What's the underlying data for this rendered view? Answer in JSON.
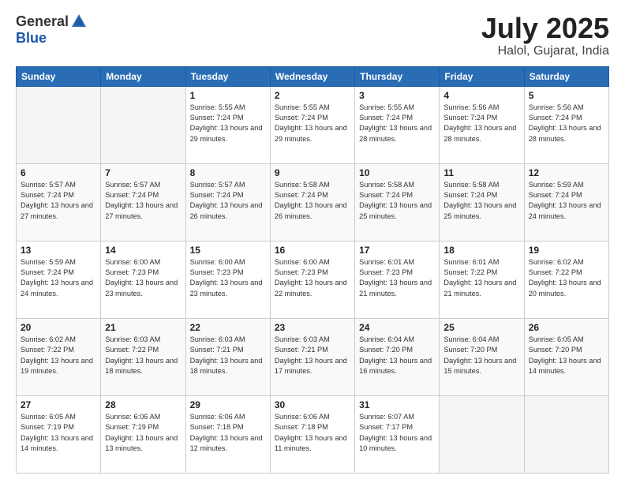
{
  "logo": {
    "general": "General",
    "blue": "Blue"
  },
  "title": {
    "month": "July 2025",
    "location": "Halol, Gujarat, India"
  },
  "headers": [
    "Sunday",
    "Monday",
    "Tuesday",
    "Wednesday",
    "Thursday",
    "Friday",
    "Saturday"
  ],
  "weeks": [
    [
      {
        "day": "",
        "info": ""
      },
      {
        "day": "",
        "info": ""
      },
      {
        "day": "1",
        "info": "Sunrise: 5:55 AM\nSunset: 7:24 PM\nDaylight: 13 hours\nand 29 minutes."
      },
      {
        "day": "2",
        "info": "Sunrise: 5:55 AM\nSunset: 7:24 PM\nDaylight: 13 hours\nand 29 minutes."
      },
      {
        "day": "3",
        "info": "Sunrise: 5:55 AM\nSunset: 7:24 PM\nDaylight: 13 hours\nand 28 minutes."
      },
      {
        "day": "4",
        "info": "Sunrise: 5:56 AM\nSunset: 7:24 PM\nDaylight: 13 hours\nand 28 minutes."
      },
      {
        "day": "5",
        "info": "Sunrise: 5:56 AM\nSunset: 7:24 PM\nDaylight: 13 hours\nand 28 minutes."
      }
    ],
    [
      {
        "day": "6",
        "info": "Sunrise: 5:57 AM\nSunset: 7:24 PM\nDaylight: 13 hours\nand 27 minutes."
      },
      {
        "day": "7",
        "info": "Sunrise: 5:57 AM\nSunset: 7:24 PM\nDaylight: 13 hours\nand 27 minutes."
      },
      {
        "day": "8",
        "info": "Sunrise: 5:57 AM\nSunset: 7:24 PM\nDaylight: 13 hours\nand 26 minutes."
      },
      {
        "day": "9",
        "info": "Sunrise: 5:58 AM\nSunset: 7:24 PM\nDaylight: 13 hours\nand 26 minutes."
      },
      {
        "day": "10",
        "info": "Sunrise: 5:58 AM\nSunset: 7:24 PM\nDaylight: 13 hours\nand 25 minutes."
      },
      {
        "day": "11",
        "info": "Sunrise: 5:58 AM\nSunset: 7:24 PM\nDaylight: 13 hours\nand 25 minutes."
      },
      {
        "day": "12",
        "info": "Sunrise: 5:59 AM\nSunset: 7:24 PM\nDaylight: 13 hours\nand 24 minutes."
      }
    ],
    [
      {
        "day": "13",
        "info": "Sunrise: 5:59 AM\nSunset: 7:24 PM\nDaylight: 13 hours\nand 24 minutes."
      },
      {
        "day": "14",
        "info": "Sunrise: 6:00 AM\nSunset: 7:23 PM\nDaylight: 13 hours\nand 23 minutes."
      },
      {
        "day": "15",
        "info": "Sunrise: 6:00 AM\nSunset: 7:23 PM\nDaylight: 13 hours\nand 23 minutes."
      },
      {
        "day": "16",
        "info": "Sunrise: 6:00 AM\nSunset: 7:23 PM\nDaylight: 13 hours\nand 22 minutes."
      },
      {
        "day": "17",
        "info": "Sunrise: 6:01 AM\nSunset: 7:23 PM\nDaylight: 13 hours\nand 21 minutes."
      },
      {
        "day": "18",
        "info": "Sunrise: 6:01 AM\nSunset: 7:22 PM\nDaylight: 13 hours\nand 21 minutes."
      },
      {
        "day": "19",
        "info": "Sunrise: 6:02 AM\nSunset: 7:22 PM\nDaylight: 13 hours\nand 20 minutes."
      }
    ],
    [
      {
        "day": "20",
        "info": "Sunrise: 6:02 AM\nSunset: 7:22 PM\nDaylight: 13 hours\nand 19 minutes."
      },
      {
        "day": "21",
        "info": "Sunrise: 6:03 AM\nSunset: 7:22 PM\nDaylight: 13 hours\nand 18 minutes."
      },
      {
        "day": "22",
        "info": "Sunrise: 6:03 AM\nSunset: 7:21 PM\nDaylight: 13 hours\nand 18 minutes."
      },
      {
        "day": "23",
        "info": "Sunrise: 6:03 AM\nSunset: 7:21 PM\nDaylight: 13 hours\nand 17 minutes."
      },
      {
        "day": "24",
        "info": "Sunrise: 6:04 AM\nSunset: 7:20 PM\nDaylight: 13 hours\nand 16 minutes."
      },
      {
        "day": "25",
        "info": "Sunrise: 6:04 AM\nSunset: 7:20 PM\nDaylight: 13 hours\nand 15 minutes."
      },
      {
        "day": "26",
        "info": "Sunrise: 6:05 AM\nSunset: 7:20 PM\nDaylight: 13 hours\nand 14 minutes."
      }
    ],
    [
      {
        "day": "27",
        "info": "Sunrise: 6:05 AM\nSunset: 7:19 PM\nDaylight: 13 hours\nand 14 minutes."
      },
      {
        "day": "28",
        "info": "Sunrise: 6:06 AM\nSunset: 7:19 PM\nDaylight: 13 hours\nand 13 minutes."
      },
      {
        "day": "29",
        "info": "Sunrise: 6:06 AM\nSunset: 7:18 PM\nDaylight: 13 hours\nand 12 minutes."
      },
      {
        "day": "30",
        "info": "Sunrise: 6:06 AM\nSunset: 7:18 PM\nDaylight: 13 hours\nand 11 minutes."
      },
      {
        "day": "31",
        "info": "Sunrise: 6:07 AM\nSunset: 7:17 PM\nDaylight: 13 hours\nand 10 minutes."
      },
      {
        "day": "",
        "info": ""
      },
      {
        "day": "",
        "info": ""
      }
    ]
  ]
}
